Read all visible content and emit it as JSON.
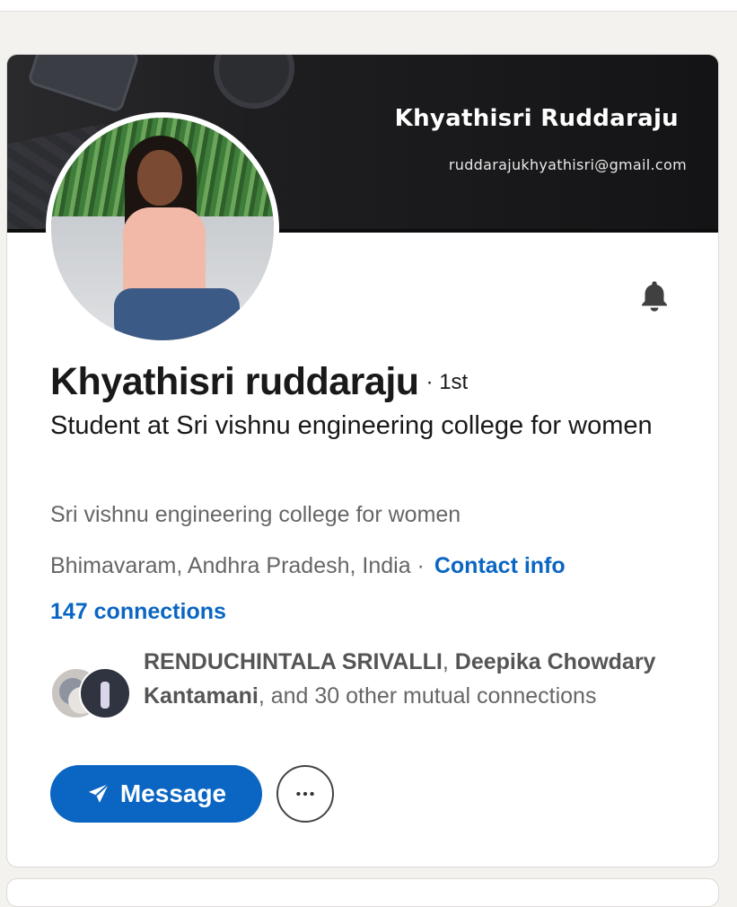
{
  "banner": {
    "name": "Khyathisri Ruddaraju",
    "email": "ruddarajukhyathisri@gmail.com"
  },
  "profile": {
    "name": "Khyathisri ruddaraju",
    "degree": "· 1st",
    "headline": "Student at Sri vishnu engineering college for women",
    "school": "Sri vishnu engineering college for women",
    "location": "Bhimavaram, Andhra Pradesh, India ·",
    "contact_info": "Contact info",
    "connections": "147 connections"
  },
  "mutual": {
    "name1": "RENDUCHINTALA SRIVALLI",
    "sep": ", ",
    "name2": "Deepika Chowdary Kantamani",
    "rest": ", and 30 other mutual connections"
  },
  "actions": {
    "message_label": "Message",
    "more_icon": "more-horizontal-icon",
    "notify_icon": "bell-icon"
  },
  "colors": {
    "accent": "#0a66c2",
    "page_bg": "#f3f2ef"
  }
}
